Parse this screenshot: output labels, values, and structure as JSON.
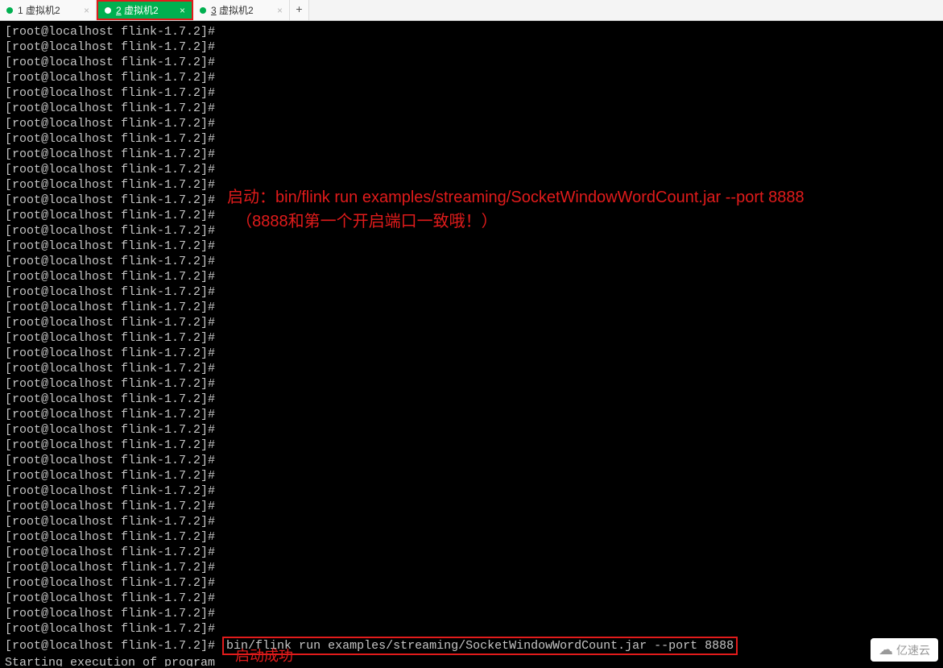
{
  "tabs": [
    {
      "index": "1",
      "label": "虚拟机2"
    },
    {
      "index": "2",
      "label": "虚拟机2"
    },
    {
      "index": "3",
      "label": "虚拟机2"
    }
  ],
  "active_tab_index": 1,
  "terminal": {
    "prompt": "[root@localhost flink-1.7.2]#",
    "empty_prompt_count": 40,
    "command": "bin/flink run examples/streaming/SocketWindowWordCount.jar --port 8888",
    "output": "Starting execution of program"
  },
  "annotations": {
    "top_line1": "启动：bin/flink run examples/streaming/SocketWindowWordCount.jar --port 8888",
    "top_line2": "（8888和第一个开启端口一致哦！）",
    "bottom": "启动成功"
  },
  "watermark": "亿速云"
}
